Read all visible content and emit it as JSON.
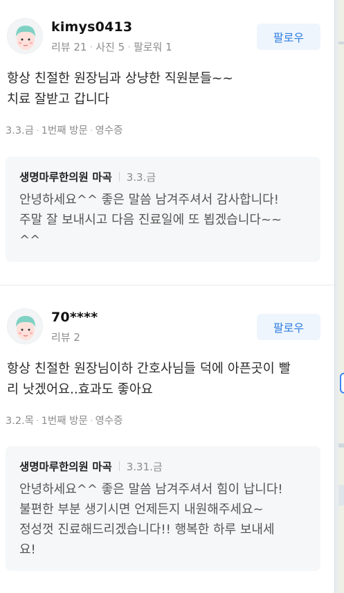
{
  "reviews": [
    {
      "nickname": "kimys0413",
      "stats": [
        "리뷰 21",
        "사진 5",
        "팔로워 1"
      ],
      "follow_label": "팔로우",
      "text": "항상 친절한 원장님과 상냥한 직원분들~~\n치료 잘받고 갑니다",
      "visit": [
        "3.3.금",
        "1번째 방문",
        "영수증"
      ],
      "reply": {
        "owner": "생명마루한의원 마곡",
        "date": "3.3.금",
        "text": "안녕하세요^^ 좋은 말씀 남겨주셔서 감사합니다!\n주말 잘 보내시고 다음 진료일에 또 뵙겠습니다~~\n^^"
      }
    },
    {
      "nickname": "70****",
      "stats": [
        "리뷰 2"
      ],
      "follow_label": "팔로우",
      "text": "항상 친절한 원장님이하 간호사님들 덕에 아픈곳이 빨\n리 낫겠어요..효과도 좋아요",
      "visit": [
        "3.2.목",
        "1번째 방문",
        "영수증"
      ],
      "reply": {
        "owner": "생명마루한의원 마곡",
        "date": "3.31.금",
        "text": "안녕하세요^^ 좋은 말씀 남겨주셔서 힘이 납니다!\n불편한 부분 생기시면 언제든지 내원해주세요~\n정성껏 진료해드리겠습니다!! 행복한 하루 보내세\n요!"
      }
    }
  ],
  "colors": {
    "accent": "#2f7de1",
    "follow_bg": "#eef5fd",
    "reply_bg": "#f5f7f8",
    "avatar_hair": "#7fd1c4",
    "avatar_face": "#ffe1dc"
  }
}
